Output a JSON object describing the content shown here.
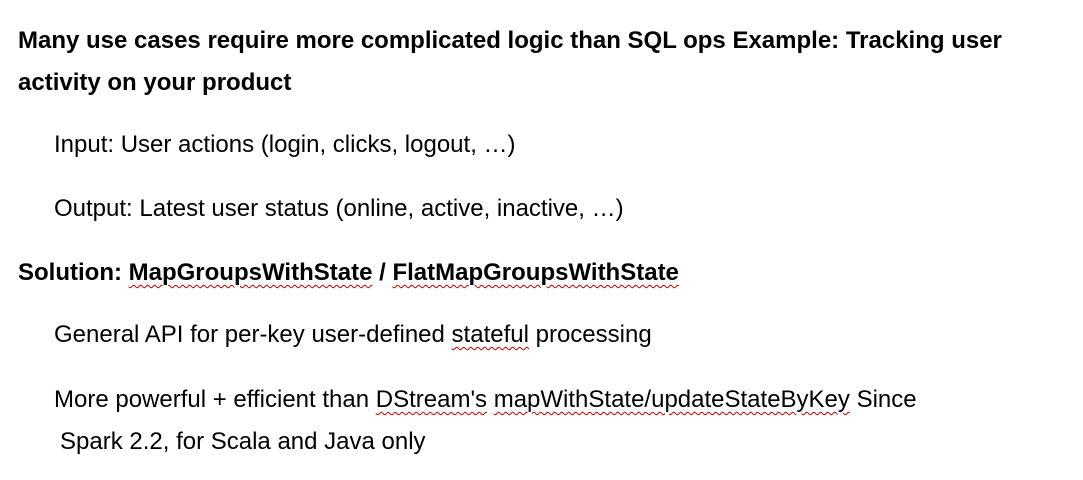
{
  "heading": "Many use cases require more complicated logic than SQL ops Example: Tracking user activity on your product",
  "input_line": "Input: User actions (login, clicks, logout, …)",
  "output_line": "Output: Latest user status (online, active, inactive, …)",
  "solution": {
    "prefix": "Solution: ",
    "api1": "MapGroupsWithState",
    "separator": " / ",
    "api2": "FlatMapGroupsWithState"
  },
  "general_api": {
    "before": "General API for per-key user-defined ",
    "flagged": "stateful",
    "after": " processing"
  },
  "powerful": {
    "before": "More powerful + efficient than ",
    "flagged1": "DStream's",
    "space": " ",
    "flagged2": "mapWithState/updateStateByKey",
    "after": " Since",
    "continuation": "Spark 2.2, for Scala and Java only"
  },
  "spellcheck_color": "#c00000"
}
